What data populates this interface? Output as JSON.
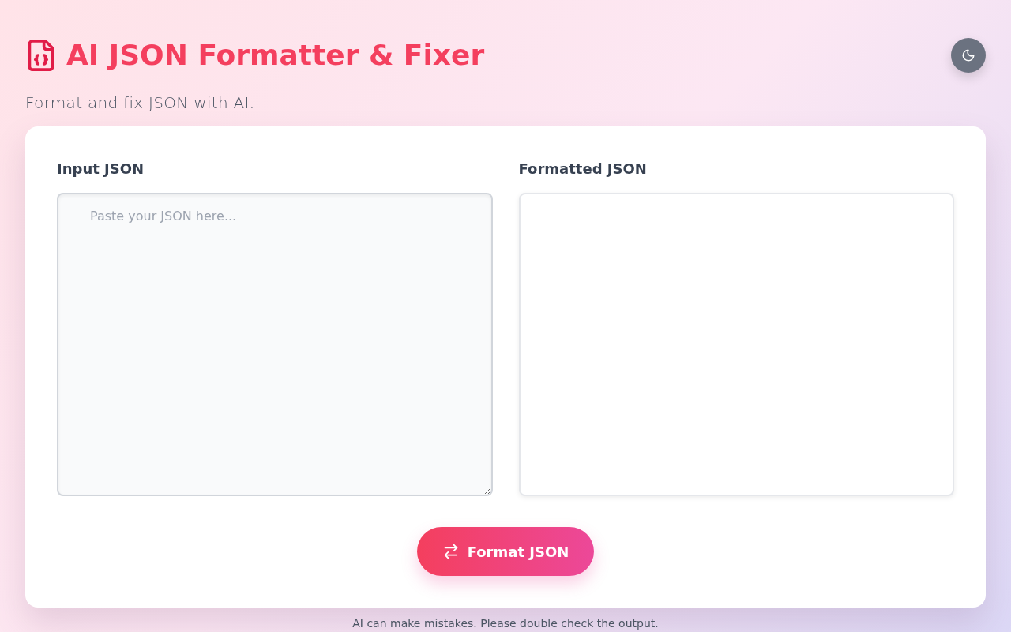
{
  "header": {
    "title": "AI JSON Formatter & Fixer",
    "subtitle": "Format and fix JSON with AI."
  },
  "input": {
    "label": "Input JSON",
    "placeholder": "Paste your JSON here..."
  },
  "output": {
    "label": "Formatted JSON"
  },
  "format_button": {
    "label": "Format JSON"
  },
  "footer": {
    "note": "AI can make mistakes. Please double check the output."
  }
}
